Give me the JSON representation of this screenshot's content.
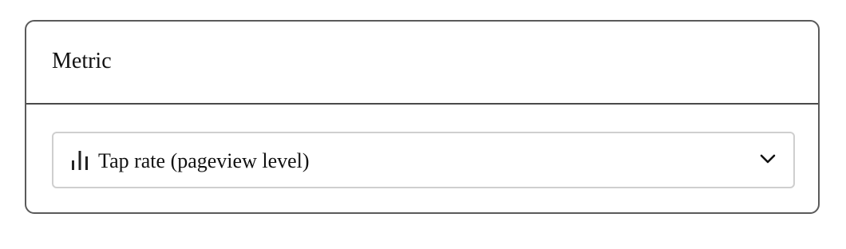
{
  "card": {
    "title": "Metric"
  },
  "metric_select": {
    "selected_value": "Tap rate (pageview level)",
    "leading_icon": "bar-chart-icon",
    "trailing_icon": "chevron-down-icon"
  }
}
